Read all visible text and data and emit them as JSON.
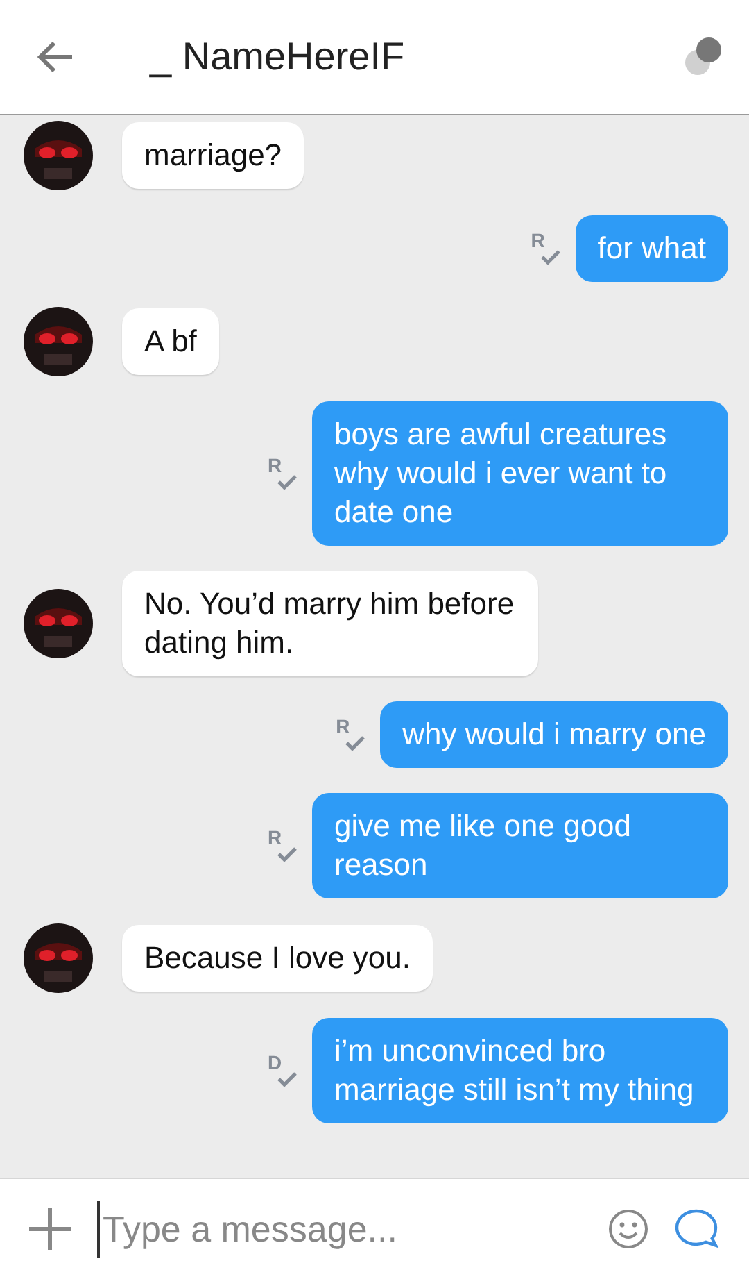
{
  "header": {
    "title": "_ NameHereIF"
  },
  "messages": [
    {
      "kind": "received",
      "text": "marriage?"
    },
    {
      "kind": "sent",
      "text": "for what",
      "receipt": "R"
    },
    {
      "kind": "received",
      "text": "A bf"
    },
    {
      "kind": "sent",
      "text": "boys are awful creatures why would i ever want to date one",
      "receipt": "R"
    },
    {
      "kind": "received",
      "text": "No. You’d marry him before dating him."
    },
    {
      "kind": "sent",
      "text": "why would i marry one",
      "receipt": "R"
    },
    {
      "kind": "sent",
      "text": "give me like one good reason",
      "receipt": "R"
    },
    {
      "kind": "received",
      "text": "Because I love you."
    },
    {
      "kind": "sent",
      "text": "i’m unconvinced bro marriage still isn’t my thing",
      "receipt": "D"
    }
  ],
  "composer": {
    "placeholder": "Type a message..."
  }
}
